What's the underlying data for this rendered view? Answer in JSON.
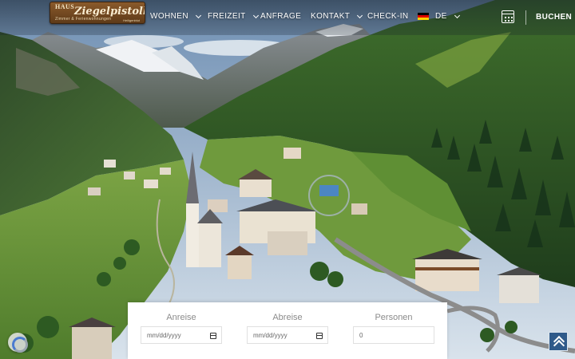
{
  "header": {
    "logo": {
      "line1": "HAUS",
      "name": "Ziegelpistoll",
      "line3": "Zimmer & Ferienwohnungen",
      "line4": "Heiligenblut"
    },
    "nav": [
      {
        "label": "WOHNEN",
        "dropdown": true
      },
      {
        "label": "FREIZEIT",
        "dropdown": true
      },
      {
        "label": "ANFRAGE",
        "dropdown": false
      },
      {
        "label": "KONTAKT",
        "dropdown": true
      },
      {
        "label": "CHECK-IN",
        "dropdown": false
      }
    ],
    "language": {
      "label": "DE",
      "flag": "germany-flag"
    },
    "calendar_icon": "calendar-icon",
    "book_label": "BUCHEN"
  },
  "booking": {
    "arrival": {
      "label": "Anreise",
      "placeholder": "mm/dd/yyyy"
    },
    "departure": {
      "label": "Abreise",
      "placeholder": "mm/dd/yyyy"
    },
    "persons": {
      "label": "Personen",
      "value": "0"
    }
  },
  "colors": {
    "topbar": "#1e2a36",
    "to_top_button": "#2f5a8a",
    "logo_wood": "#8a5a2b"
  },
  "icons": [
    "calendar-icon",
    "chevron-down-icon",
    "recaptcha-icon",
    "arrow-up-icon"
  ]
}
